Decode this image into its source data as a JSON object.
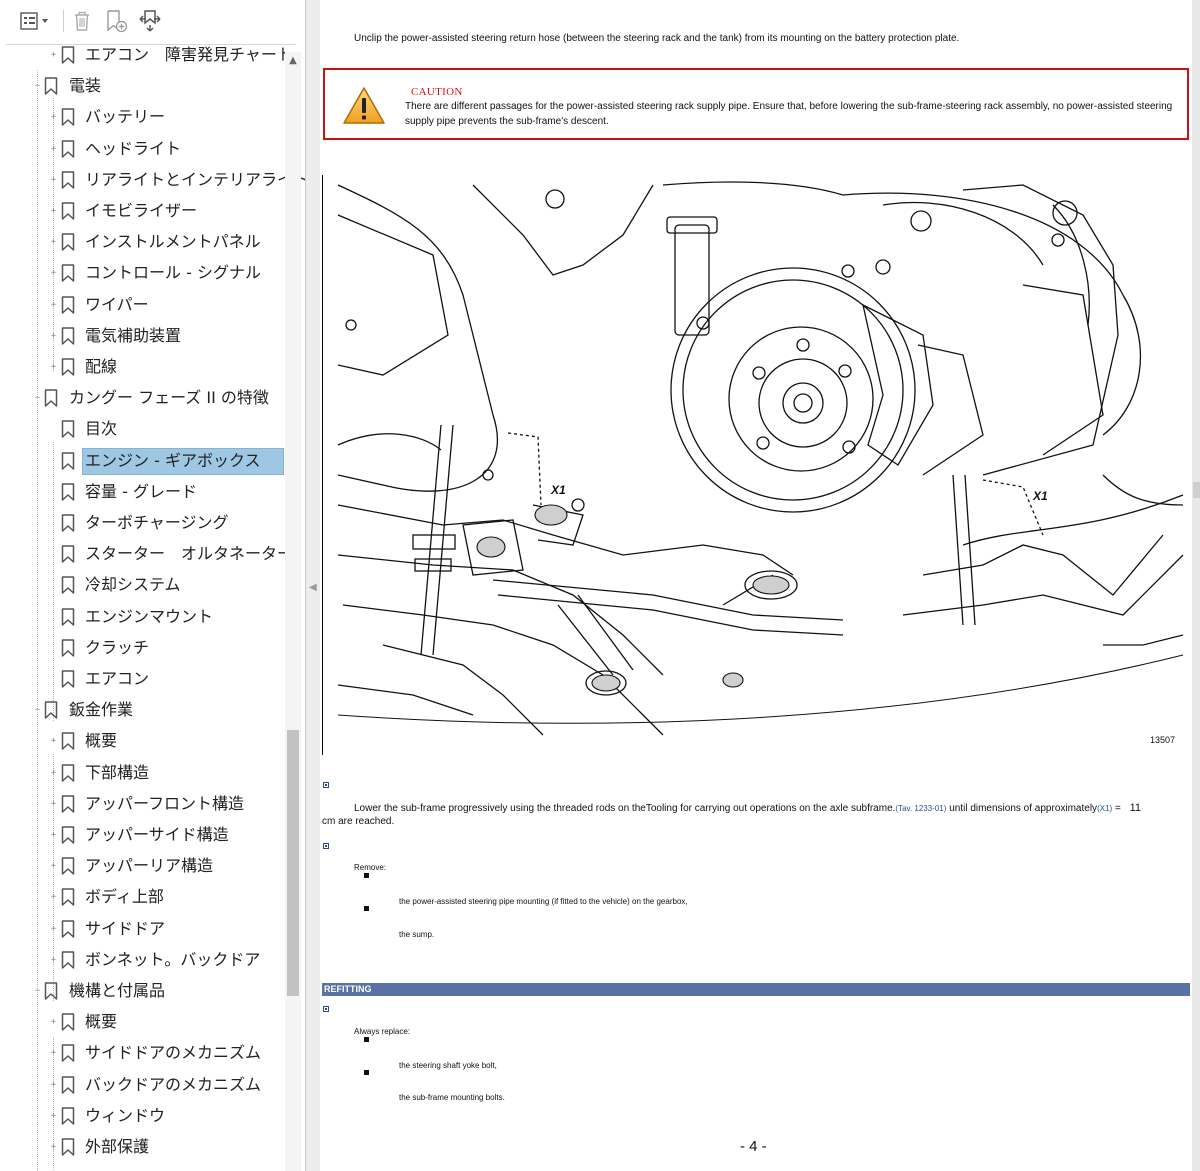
{
  "sidebar": {
    "items": [
      {
        "label": "エアコン　障害発見チャート",
        "level": 2,
        "expander": "plus"
      },
      {
        "label": "電装",
        "level": 1,
        "expander": "minus"
      },
      {
        "label": "バッテリー",
        "level": 2,
        "expander": "plus"
      },
      {
        "label": "ヘッドライト",
        "level": 2,
        "expander": "plus"
      },
      {
        "label": "リアライトとインテリアライト",
        "level": 2,
        "expander": "plus"
      },
      {
        "label": "イモビライザー",
        "level": 2,
        "expander": "plus"
      },
      {
        "label": "インストルメントパネル",
        "level": 2,
        "expander": "plus"
      },
      {
        "label": "コントロール - シグナル",
        "level": 2,
        "expander": "plus"
      },
      {
        "label": "ワイパー",
        "level": 2,
        "expander": "plus"
      },
      {
        "label": "電気補助装置",
        "level": 2,
        "expander": "plus"
      },
      {
        "label": "配線",
        "level": 2,
        "expander": "plus"
      },
      {
        "label": "カングー フェーズ II の特徴",
        "level": 1,
        "expander": "minus"
      },
      {
        "label": "目次",
        "level": 2,
        "expander": "none"
      },
      {
        "label": "エンジン - ギアボックス",
        "level": 2,
        "expander": "none",
        "selected": true
      },
      {
        "label": "容量 - グレード",
        "level": 2,
        "expander": "none"
      },
      {
        "label": "ターボチャージング",
        "level": 2,
        "expander": "none"
      },
      {
        "label": "スターター　オルタネーター",
        "level": 2,
        "expander": "none"
      },
      {
        "label": "冷却システム",
        "level": 2,
        "expander": "none"
      },
      {
        "label": "エンジンマウント",
        "level": 2,
        "expander": "none"
      },
      {
        "label": "クラッチ",
        "level": 2,
        "expander": "none"
      },
      {
        "label": "エアコン",
        "level": 2,
        "expander": "none"
      },
      {
        "label": "鈑金作業",
        "level": 1,
        "expander": "minus"
      },
      {
        "label": "概要",
        "level": 2,
        "expander": "plus"
      },
      {
        "label": "下部構造",
        "level": 2,
        "expander": "plus"
      },
      {
        "label": "アッパーフロント構造",
        "level": 2,
        "expander": "plus"
      },
      {
        "label": "アッパーサイド構造",
        "level": 2,
        "expander": "plus"
      },
      {
        "label": "アッパーリア構造",
        "level": 2,
        "expander": "plus"
      },
      {
        "label": "ボディ上部",
        "level": 2,
        "expander": "plus"
      },
      {
        "label": "サイドドア",
        "level": 2,
        "expander": "plus"
      },
      {
        "label": "ボンネット。バックドア",
        "level": 2,
        "expander": "plus"
      },
      {
        "label": "機構と付属品",
        "level": 1,
        "expander": "minus"
      },
      {
        "label": "概要",
        "level": 2,
        "expander": "plus"
      },
      {
        "label": "サイドドアのメカニズム",
        "level": 2,
        "expander": "plus"
      },
      {
        "label": "バックドアのメカニズム",
        "level": 2,
        "expander": "plus"
      },
      {
        "label": "ウィンドウ",
        "level": 2,
        "expander": "plus"
      },
      {
        "label": "外部保護",
        "level": 2,
        "expander": "plus"
      }
    ],
    "toolbar": {
      "options_icon": "list-options-icon",
      "delete_icon": "trash-icon",
      "new_bookmark_icon": "add-bookmark-icon",
      "find_bookmark_icon": "find-bookmark-icon"
    },
    "selection_color": "#9ec7e4"
  },
  "document": {
    "intro": "Unclip the power-assisted steering return hose (between the steering rack and the tank) from its mounting on the battery protection plate.",
    "caution_title": "CAUTION",
    "caution_text": "There are different passages for the power-assisted steering rack supply pipe. Ensure that, before lowering the sub-frame-steering rack assembly, no power-assisted steering supply pipe prevents the sub-frame's descent.",
    "figure_labels": [
      "X1",
      "X1"
    ],
    "figure_number": "13507",
    "step1_a": "Lower the sub-frame progressively using the threaded rods on theTooling for carrying out operations on the axle subframe.",
    "step1_ref": "(Tav.  1233-01)",
    "step1_b": " until dimensions of approximately",
    "step1_x1": "(X1)",
    "step1_eq": " = ",
    "step1_val": "11",
    "step1_tail": "cm are reached.",
    "remove_label": "Remove:",
    "remove_items": [
      "the power-assisted steering pipe mounting (if fitted to the vehicle) on the gearbox,",
      "the sump."
    ],
    "section_refitting": "REFITTING",
    "always_replace": "Always  replace:",
    "replace_items": [
      "the steering shaft yoke bolt,",
      "the sub-frame mounting bolts."
    ],
    "page_number": "- 4 -",
    "caution_color": "#cc1111",
    "section_bar_color": "#5772a3"
  }
}
